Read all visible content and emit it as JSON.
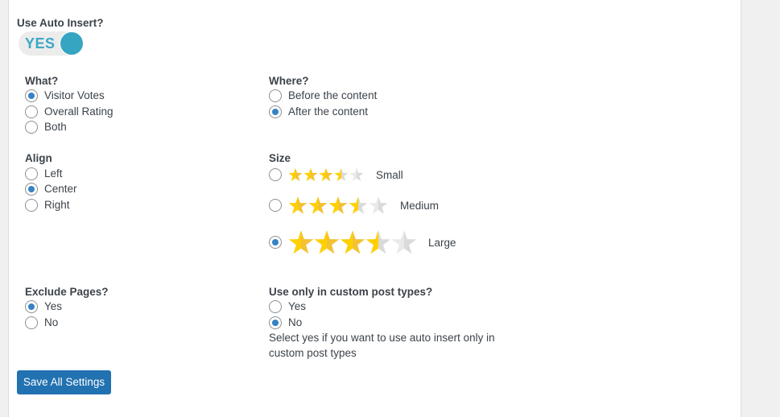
{
  "auto_insert": {
    "label": "Use Auto Insert?",
    "toggle_value": "YES",
    "enabled": true,
    "accent_color": "#36a5c2"
  },
  "what": {
    "label": "What?",
    "options": [
      "Visitor Votes",
      "Overall Rating",
      "Both"
    ],
    "selected": "Visitor Votes"
  },
  "where": {
    "label": "Where?",
    "options": [
      "Before the content",
      "After the content"
    ],
    "selected": "After the content"
  },
  "align": {
    "label": "Align",
    "options": [
      "Left",
      "Center",
      "Right"
    ],
    "selected": "Center"
  },
  "size": {
    "label": "Size",
    "options": [
      {
        "label": "Small",
        "rating": 3.5,
        "max": 5
      },
      {
        "label": "Medium",
        "rating": 3.5,
        "max": 5
      },
      {
        "label": "Large",
        "rating": 3.5,
        "max": 5
      }
    ],
    "selected": "Large",
    "star_colors": {
      "filled": "#ffd000",
      "filled_shade": "#f3c232",
      "empty": "#e9e9e9",
      "empty_shade": "#dadada"
    }
  },
  "exclude_pages": {
    "label": "Exclude Pages?",
    "options": [
      "Yes",
      "No"
    ],
    "selected": "Yes"
  },
  "custom_post_types": {
    "label": "Use only in custom post types?",
    "options": [
      "Yes",
      "No"
    ],
    "selected": "No",
    "help_text": "Select yes if you want to use auto insert only in custom post types"
  },
  "actions": {
    "save_label": "Save All Settings"
  },
  "colors": {
    "radio_checked": "#3582c4",
    "button_bg": "#2271b1"
  }
}
